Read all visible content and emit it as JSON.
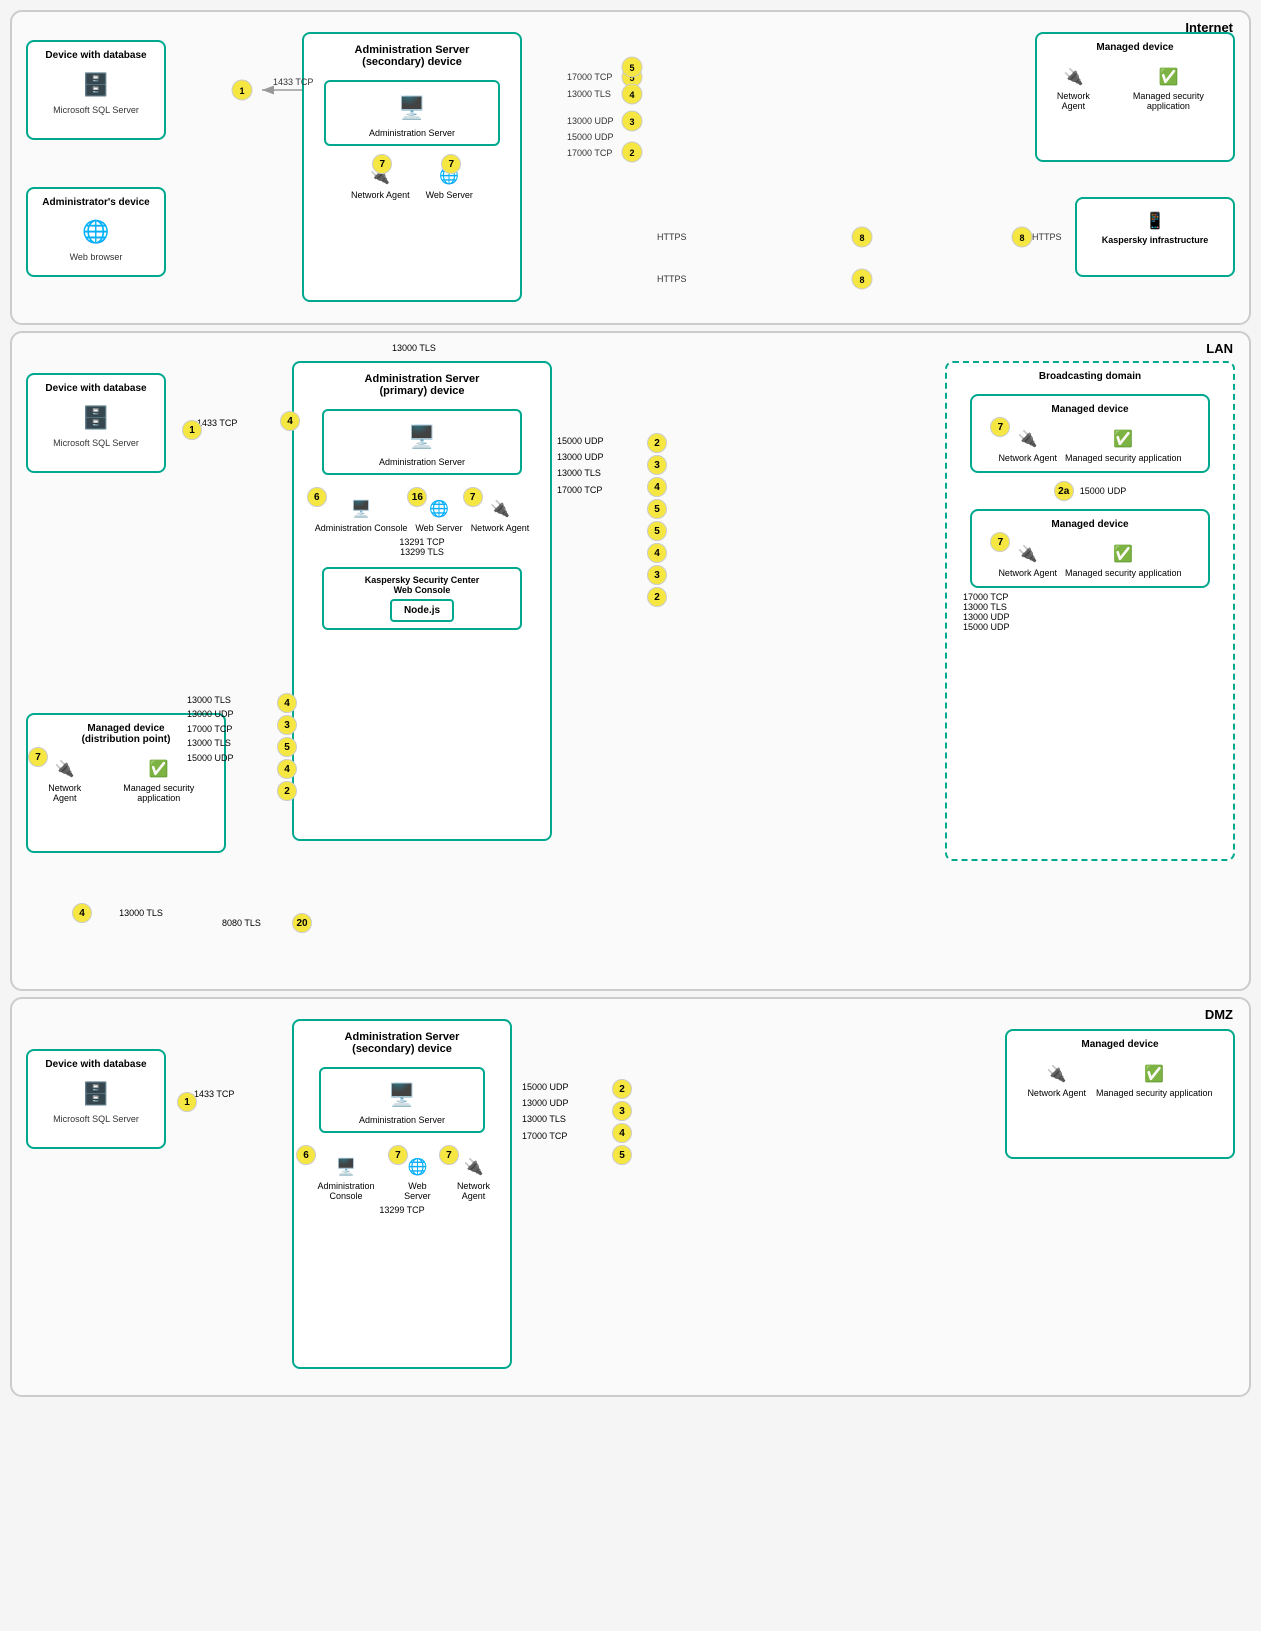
{
  "zones": {
    "internet": {
      "label": "Internet",
      "devices": {
        "db_device": {
          "title": "Device with database",
          "subtitle": "Microsoft SQL Server"
        },
        "admin_device": {
          "title": "Administrator's device",
          "subtitle": "Web browser"
        },
        "admin_server_secondary": {
          "title": "Administration Server",
          "subtitle": "(secondary) device"
        },
        "admin_server_label": "Administration Server",
        "network_agent": "Network Agent",
        "web_server": "Web Server",
        "managed_device": {
          "title": "Managed device"
        },
        "network_agent2": "Network Agent",
        "managed_security": "Managed security application",
        "kaspersky": "Kaspersky infrastructure"
      },
      "protocols": {
        "p1": "1433 TCP",
        "p2": "17000 TCP",
        "p3": "13000 TLS",
        "p4": "13000 UDP",
        "p5": "15000 UDP",
        "p6": "17000 TCP",
        "p7": "HTTPS"
      },
      "badges": [
        "1",
        "5",
        "4",
        "3",
        "2",
        "5",
        "7",
        "7",
        "8",
        "8",
        "8"
      ]
    },
    "lan": {
      "label": "LAN",
      "devices": {
        "db_device": {
          "title": "Device with database",
          "subtitle": "Microsoft SQL Server"
        },
        "admin_server_primary": {
          "title": "Administration Server",
          "subtitle": "(primary) device"
        },
        "admin_server_label": "Administration Server",
        "admin_console": "Administration Console",
        "web_server": "Web Server",
        "network_agent": "Network Agent",
        "ksc_web_console": "Kaspersky Security Center Web Console",
        "nodejs": "Node.js",
        "dist_point": {
          "title": "Managed device",
          "subtitle": "(distribution point)"
        },
        "network_agent_dp": "Network Agent",
        "managed_security_dp": "Managed security application",
        "broadcasting": "Broadcasting domain",
        "managed_dev1": "Managed device",
        "network_agent1": "Network Agent",
        "managed_security1": "Managed security application",
        "managed_dev2": "Managed device",
        "network_agent2": "Network Agent",
        "managed_security2": "Managed security application"
      },
      "protocols": {
        "tls13000": "13000 TLS",
        "udp13000": "13000 UDP",
        "tcp17000": "17000 TCP",
        "tls13000b": "13000 TLS",
        "udp15000": "15000 UDP",
        "tcp1433": "1433 TCP",
        "tcp13291": "13291 TCP",
        "tls13299": "13299 TLS",
        "tls8080": "8080 TLS",
        "tls13000c": "13000 TLS",
        "udp15000b": "15000 UDP",
        "udp13000b": "13000 UDP",
        "tls13000d": "13000 TLS",
        "tcp17000b": "17000 TCP",
        "udp15000c": "15000 UDP",
        "udp13000c": "13000 UDP",
        "tls13000e": "13000 TLS",
        "tcp17000c": "17000 TCP"
      },
      "badges": [
        "4",
        "1",
        "4",
        "3",
        "5",
        "4",
        "2",
        "6",
        "16",
        "7",
        "7",
        "20",
        "7",
        "2a",
        "7",
        "2",
        "3",
        "4",
        "5",
        "5",
        "4",
        "3",
        "2"
      ]
    },
    "dmz": {
      "label": "DMZ",
      "devices": {
        "db_device": {
          "title": "Device with database",
          "subtitle": "Microsoft SQL Server"
        },
        "admin_server_secondary": {
          "title": "Administration Server",
          "subtitle": "(secondary) device"
        },
        "admin_server_label": "Administration Server",
        "admin_console": "Administration Console",
        "web_server": "Web Server",
        "network_agent": "Network Agent",
        "managed_device": "Managed device",
        "network_agent2": "Network Agent",
        "managed_security": "Managed security application"
      },
      "protocols": {
        "tcp1433": "1433 TCP",
        "udp15000": "15000 UDP",
        "udp13000": "13000 UDP",
        "tls13000": "13000 TLS",
        "tcp17000": "17000 TCP",
        "tcp13299": "13299 TCP"
      },
      "badges": [
        "1",
        "2",
        "3",
        "4",
        "5",
        "6",
        "7",
        "7"
      ]
    }
  }
}
